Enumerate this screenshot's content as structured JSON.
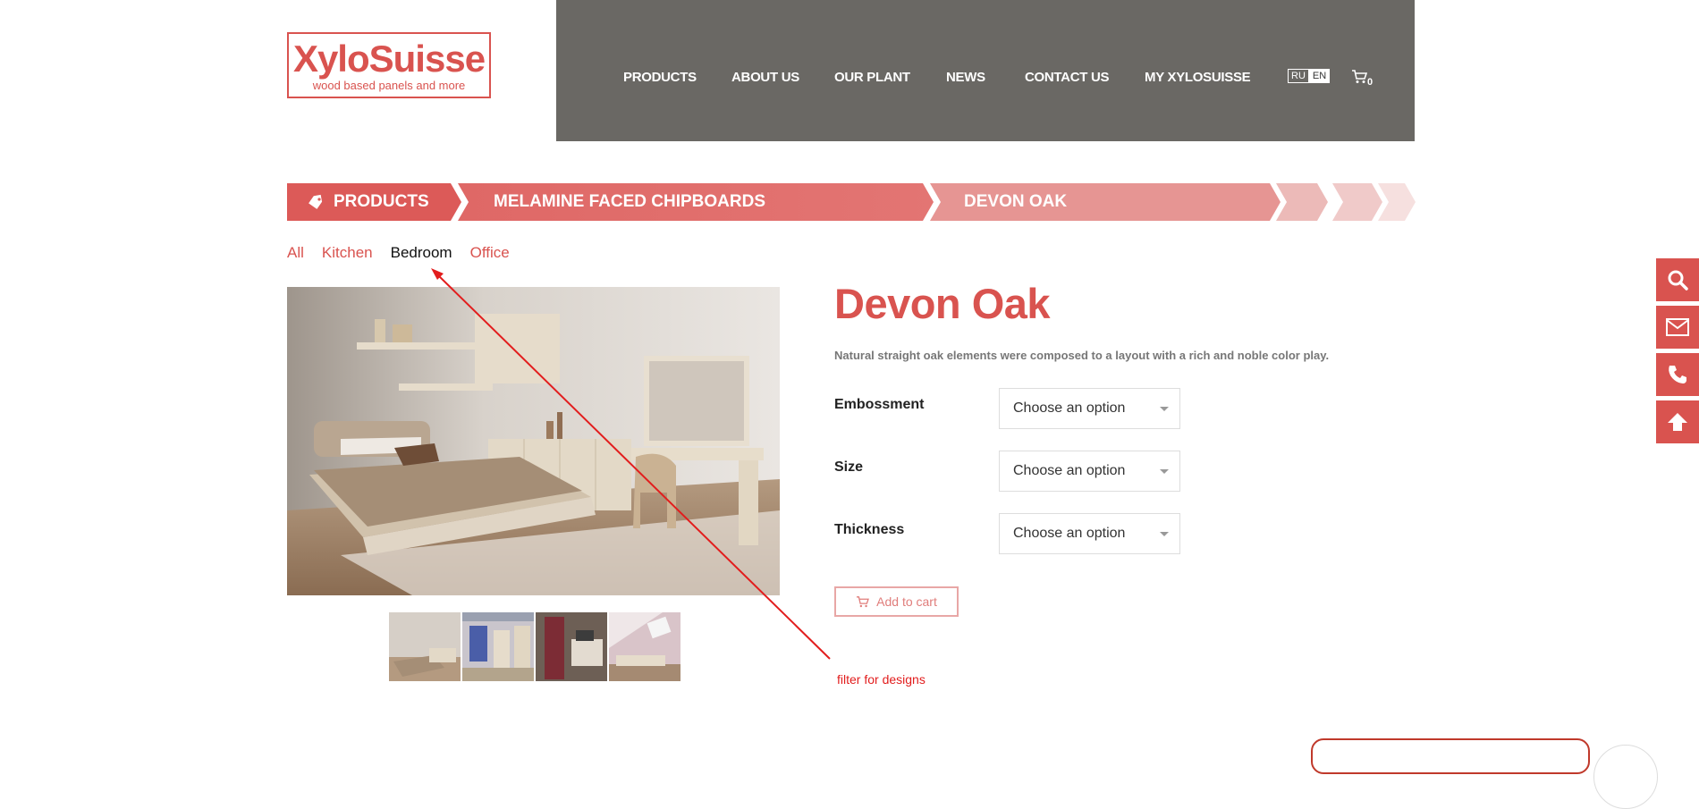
{
  "brand": {
    "logo_text": "XyloSuisse",
    "logo_tagline": "wood based panels and more",
    "accent_color": "#d9534f",
    "header_color": "#6a6864"
  },
  "nav": {
    "items": [
      {
        "label": "PRODUCTS"
      },
      {
        "label": "ABOUT US"
      },
      {
        "label": "OUR PLANT"
      },
      {
        "label": "NEWS"
      },
      {
        "label": "CONTACT US"
      },
      {
        "label": "MY XYLOSUISSE"
      }
    ],
    "lang_ru": "RU",
    "lang_en": "EN",
    "cart_icon": "cart-icon",
    "cart_count": "0"
  },
  "breadcrumb": {
    "items": [
      {
        "label": "PRODUCTS",
        "icon": "tag-icon"
      },
      {
        "label": "MELAMINE FACED CHIPBOARDS"
      },
      {
        "label": "DEVON OAK"
      }
    ]
  },
  "filters": {
    "items": [
      {
        "label": "All"
      },
      {
        "label": "Kitchen"
      },
      {
        "label": "Bedroom",
        "active": true
      },
      {
        "label": "Office"
      }
    ]
  },
  "product": {
    "title": "Devon Oak",
    "description": "Natural straight oak elements were composed to a layout with a rich and noble color play.",
    "options": [
      {
        "label": "Embossment",
        "value": "Choose an option"
      },
      {
        "label": "Size",
        "value": "Choose an option"
      },
      {
        "label": "Thickness",
        "value": "Choose an option"
      }
    ],
    "add_to_cart": "Add to cart"
  },
  "annotation": {
    "text": "filter for designs",
    "color": "#e21d1d"
  },
  "side_tools": {
    "items": [
      {
        "icon": "search-icon"
      },
      {
        "icon": "mail-icon"
      },
      {
        "icon": "phone-icon"
      },
      {
        "icon": "arrow-up-icon"
      }
    ]
  }
}
